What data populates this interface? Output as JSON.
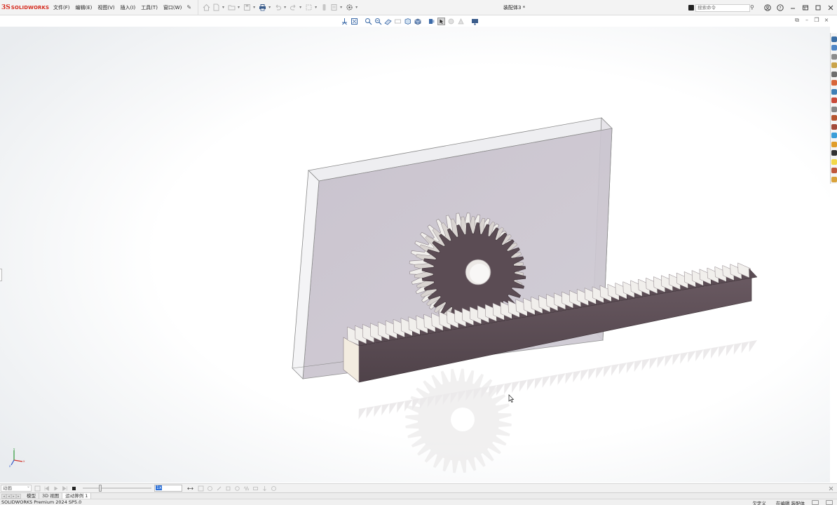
{
  "app": {
    "brand": "SOLIDWORKS",
    "document_title": "装配体3 *",
    "menus": [
      "文件(F)",
      "编辑(E)",
      "视图(V)",
      "插入(I)",
      "工具(T)",
      "窗口(W)"
    ]
  },
  "search": {
    "placeholder": "搜索命令"
  },
  "window_controls": [
    "user-icon",
    "help-icon",
    "minimize-icon",
    "restore-icon",
    "maximize-icon",
    "close-icon"
  ],
  "motion": {
    "study_type": "动画",
    "playback_speed": "1x",
    "timeline_fraction": 0.25
  },
  "tabs": [
    {
      "label": "模型",
      "active": false
    },
    {
      "label": "3D 视图",
      "active": false
    },
    {
      "label": "运动算例 1",
      "active": true
    }
  ],
  "status": {
    "app_version": "SOLIDWORKS Premium 2024 SP5.0",
    "definition_state": "欠定义",
    "editing_state": "在编辑 装配体"
  },
  "colors": {
    "brand_red": "#d52b1e",
    "gear_dark": "#5b4c54",
    "gear_light": "#f1efec",
    "plate_tint": "#c9c3ce",
    "selection_blue": "#2a6fd8"
  }
}
